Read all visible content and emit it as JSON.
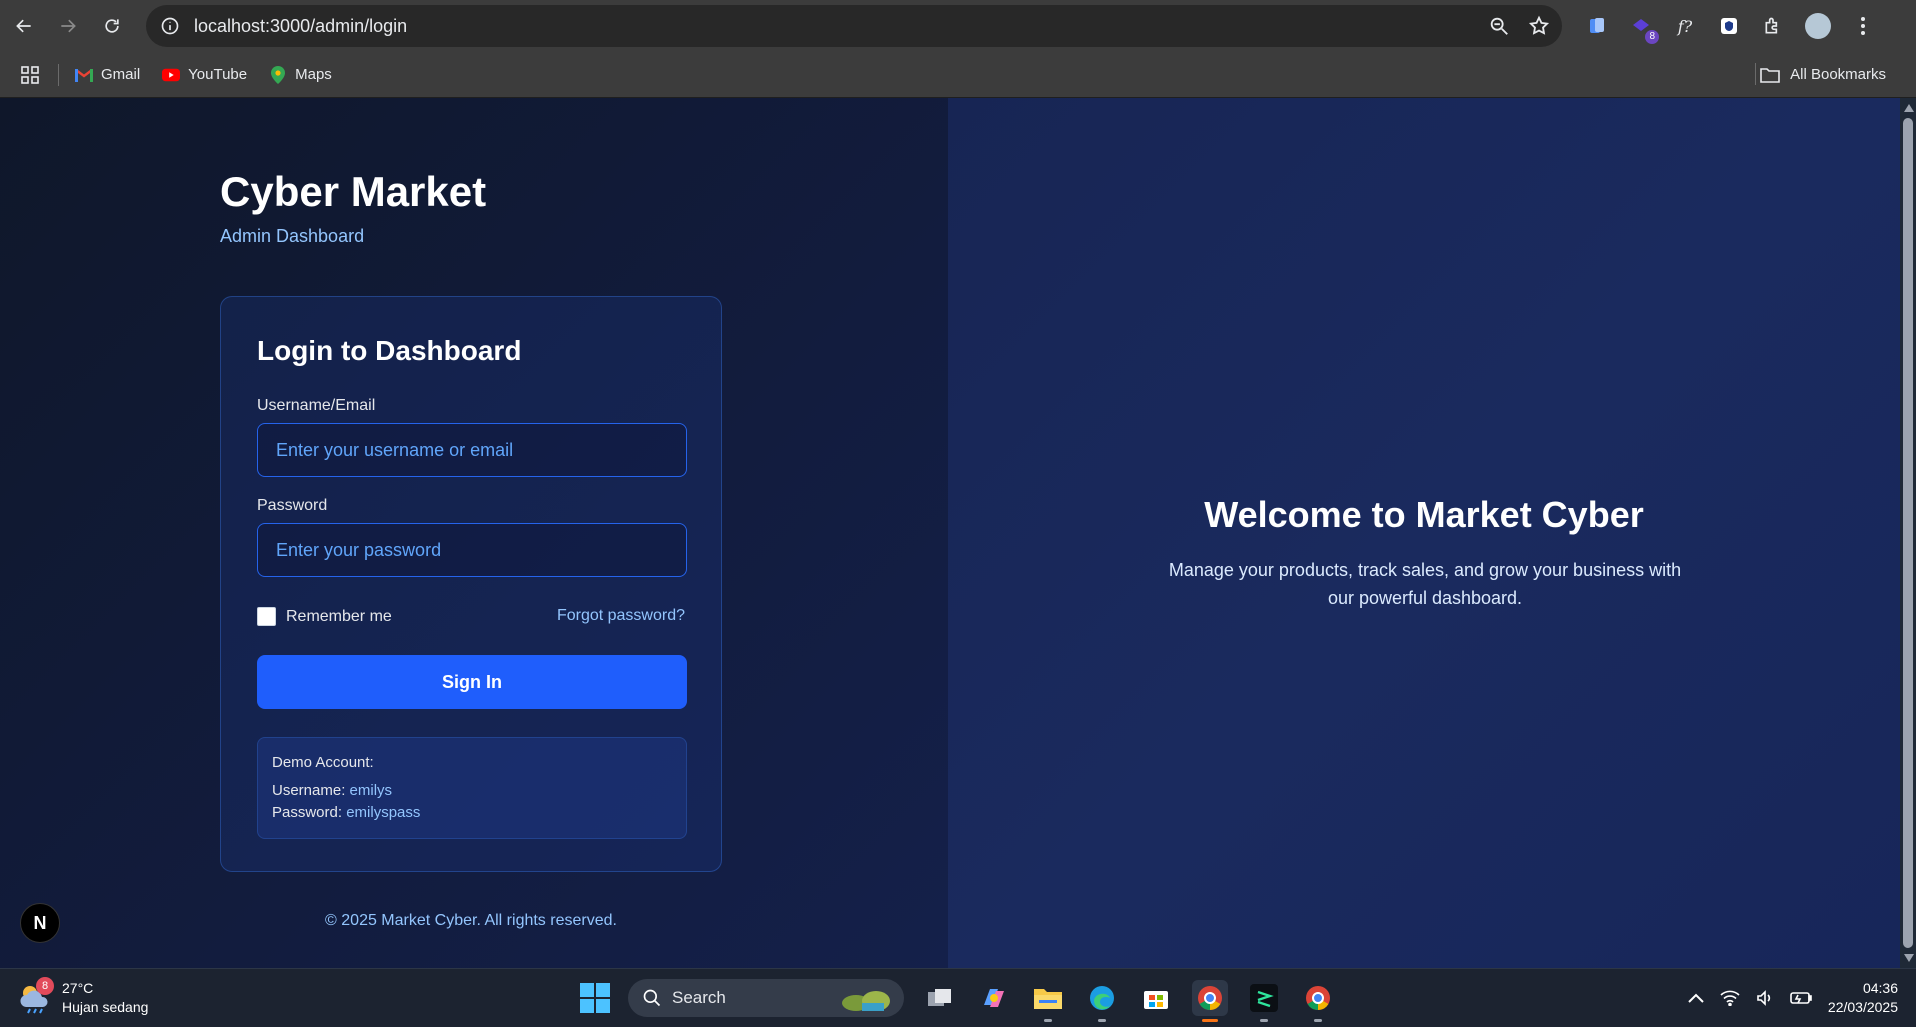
{
  "browser": {
    "url": "localhost:3000/admin/login",
    "extension_badge": "8",
    "bookmarks": [
      {
        "label": "Gmail",
        "icon": "gmail-icon"
      },
      {
        "label": "YouTube",
        "icon": "youtube-icon"
      },
      {
        "label": "Maps",
        "icon": "maps-icon"
      }
    ],
    "all_bookmarks": "All Bookmarks"
  },
  "brand": {
    "title": "Cyber Market",
    "subtitle": "Admin Dashboard"
  },
  "login": {
    "title": "Login to Dashboard",
    "username_label": "Username/Email",
    "username_placeholder": "Enter your username or email",
    "password_label": "Password",
    "password_placeholder": "Enter your password",
    "remember_label": "Remember me",
    "forgot_label": "Forgot password?",
    "submit_label": "Sign In",
    "demo": {
      "heading": "Demo Account:",
      "username_key": "Username:",
      "username_value": "emilys",
      "password_key": "Password:",
      "password_value": "emilyspass"
    }
  },
  "footer": {
    "copyright": "© 2025 Market Cyber. All rights reserved."
  },
  "welcome": {
    "title": "Welcome to Market Cyber",
    "text": "Manage your products, track sales, and grow your business with our powerful dashboard."
  },
  "taskbar": {
    "weather_temp": "27°C",
    "weather_desc": "Hujan sedang",
    "weather_badge": "8",
    "search_label": "Search",
    "time": "04:36",
    "date": "22/03/2025"
  },
  "colors": {
    "accent": "#1f5efc",
    "link": "#93c5fd",
    "left_bg": "#0f172a",
    "right_bg": "#172554"
  }
}
